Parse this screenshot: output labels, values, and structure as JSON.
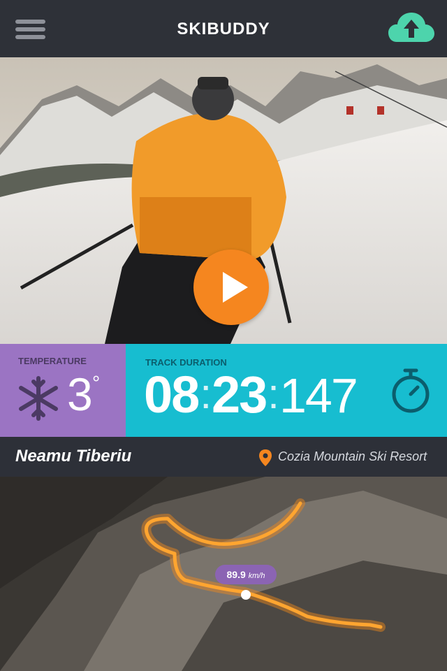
{
  "header": {
    "title": "SKIBUDDY",
    "menu_icon": "hamburger-icon",
    "upload_icon": "cloud-upload-icon",
    "accent": "#4dd4ac"
  },
  "hero": {
    "play_icon": "play-icon",
    "play_color": "#f5861f"
  },
  "stats": {
    "temperature": {
      "label": "TEMPERATURE",
      "value": "3",
      "unit": "°",
      "icon": "snowflake-icon"
    },
    "track": {
      "label": "TRACK DURATION",
      "minutes": "08",
      "seconds": "23",
      "ms": "147",
      "icon": "stopwatch-icon"
    }
  },
  "info": {
    "user_name": "Neamu Tiberiu",
    "resort": "Cozia Mountain Ski Resort",
    "pin_icon": "location-pin-icon"
  },
  "map": {
    "speed_value": "89.9",
    "speed_unit": "km/h"
  }
}
